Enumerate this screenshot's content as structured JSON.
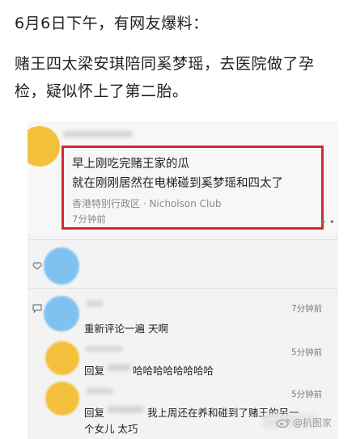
{
  "headline": "6月6日下午，有网友爆料：",
  "paragraph": "赌王四太梁安琪陪同奚梦瑶，去医院做了孕检，疑似怀上了第二胎。",
  "post": {
    "line1": "早上刚吃完赌王家的瓜",
    "line2": "就在刚刚居然在电梯碰到奚梦瑶和四太了",
    "location": "香港特别行政区 · Nicholson Club",
    "time": "7分钟前"
  },
  "comments": [
    {
      "text": "重新评论一遍 天啊",
      "time": "7分钟前"
    },
    {
      "prefix": "回复",
      "text": "哈哈哈哈哈哈哈哈",
      "time": "5分钟前"
    },
    {
      "prefix": "回复",
      "text": "我上周还在养和碰到了赌王的另一",
      "text2": "个女儿 太巧",
      "time": "5分钟前"
    }
  ],
  "watermark": "@扒图家",
  "colors": {
    "highlight_border": "#d22c2c",
    "avatar_yellow": "#f3c13b",
    "avatar_blue": "#7fc2f2"
  }
}
